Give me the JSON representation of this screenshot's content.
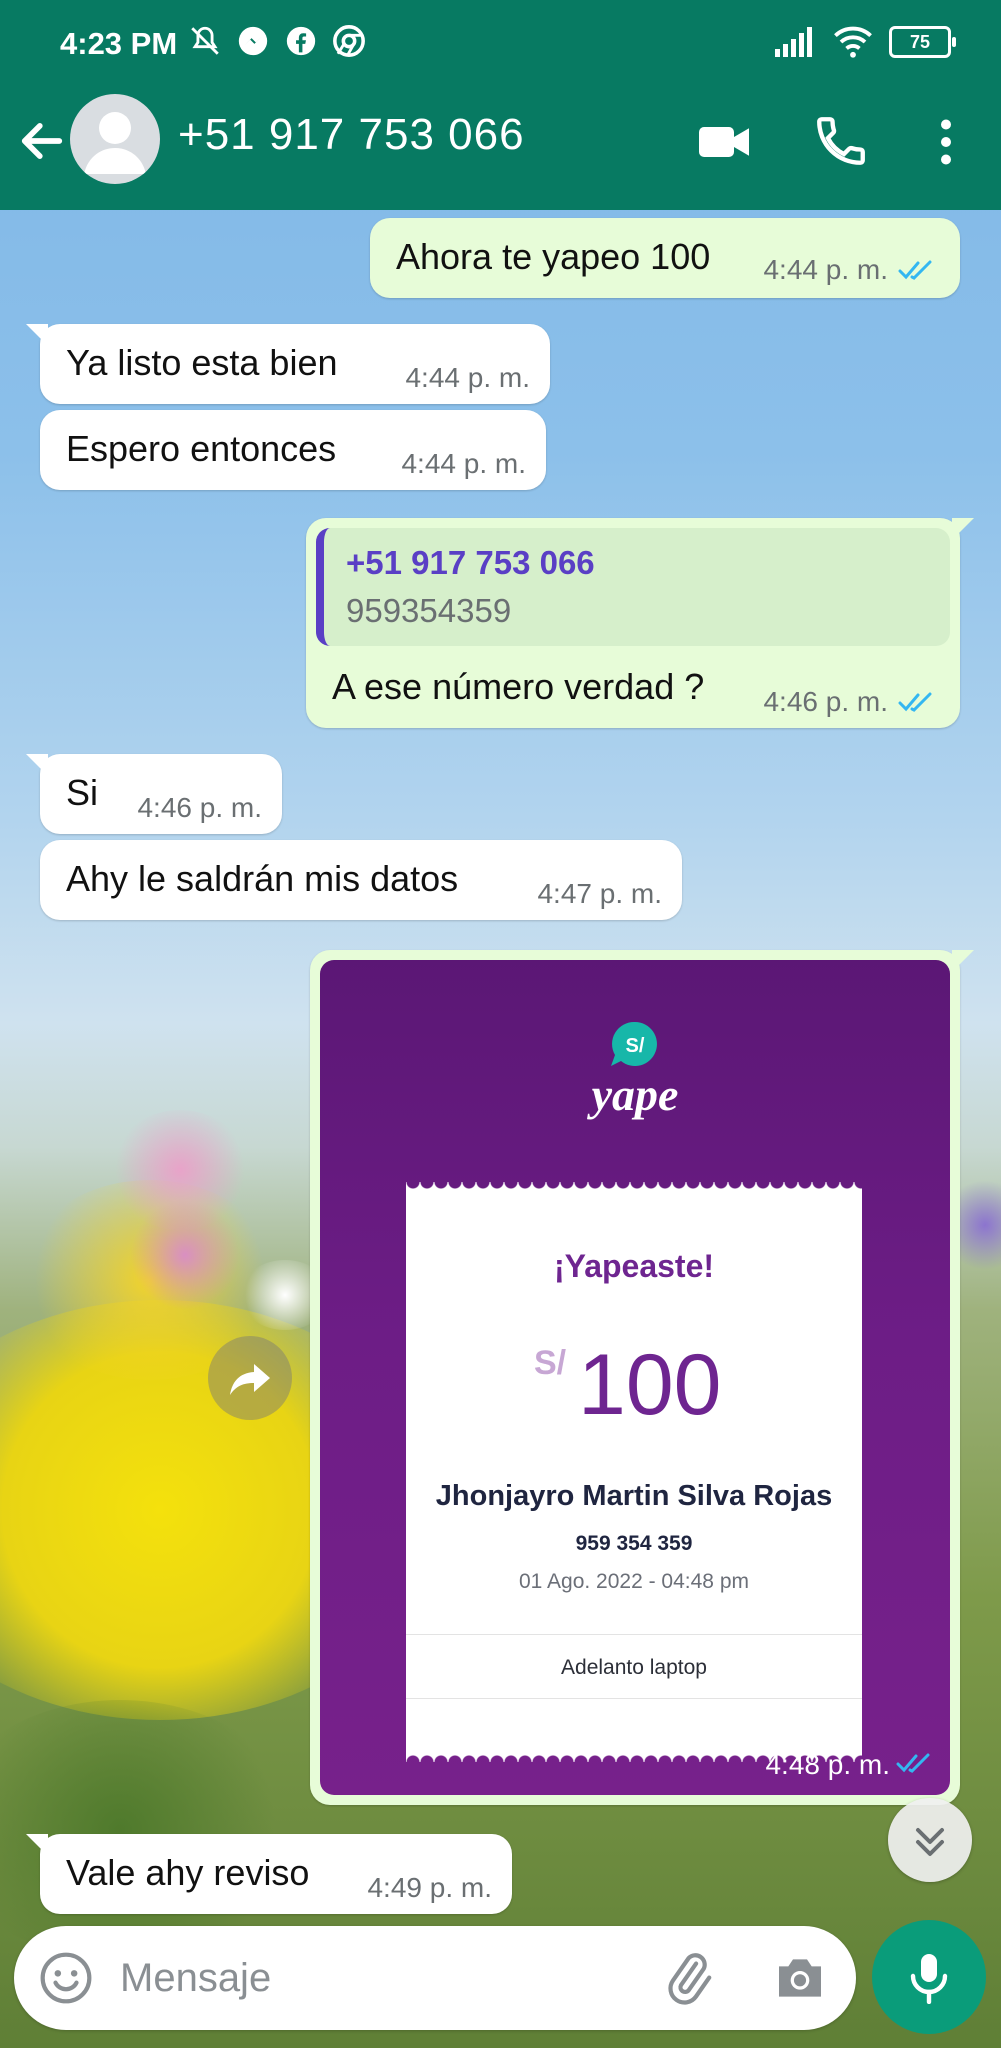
{
  "status_bar": {
    "time": "4:23 PM",
    "battery": "75"
  },
  "header": {
    "contact": "+51 917 753 066"
  },
  "messages": [
    {
      "text": "Ahora te yapeo 100",
      "time": "4:44 p. m."
    },
    {
      "text": "Ya listo esta bien",
      "time": "4:44 p. m."
    },
    {
      "text": "Espero entonces",
      "time": "4:44 p. m."
    },
    {
      "quote_name": "+51 917 753 066",
      "quote_text": "959354359",
      "text": "A ese número verdad ?",
      "time": "4:46 p. m."
    },
    {
      "text": "Si",
      "time": "4:46 p. m."
    },
    {
      "text": "Ahy le saldrán mis datos",
      "time": "4:47 p. m."
    },
    {
      "text": "Vale ahy reviso",
      "time": "4:49 p. m."
    }
  ],
  "yape": {
    "logo_badge": "S/",
    "logo_word": "yape",
    "title": "¡Yapeaste!",
    "currency": "S/",
    "amount": "100",
    "name": "Jhonjayro Martin Silva Rojas",
    "phone": "959 354 359",
    "date": "01 Ago. 2022 - 04:48 pm",
    "note": "Adelanto laptop",
    "time": "4:48 p. m."
  },
  "composer": {
    "placeholder": "Mensaje"
  },
  "colors": {
    "header": "#077a62",
    "outgoing": "#e7fcd8",
    "incoming": "#ffffff",
    "read_ticks": "#34b7f1",
    "yape_purple": "#6e2590",
    "mic": "#0a9c7a"
  }
}
